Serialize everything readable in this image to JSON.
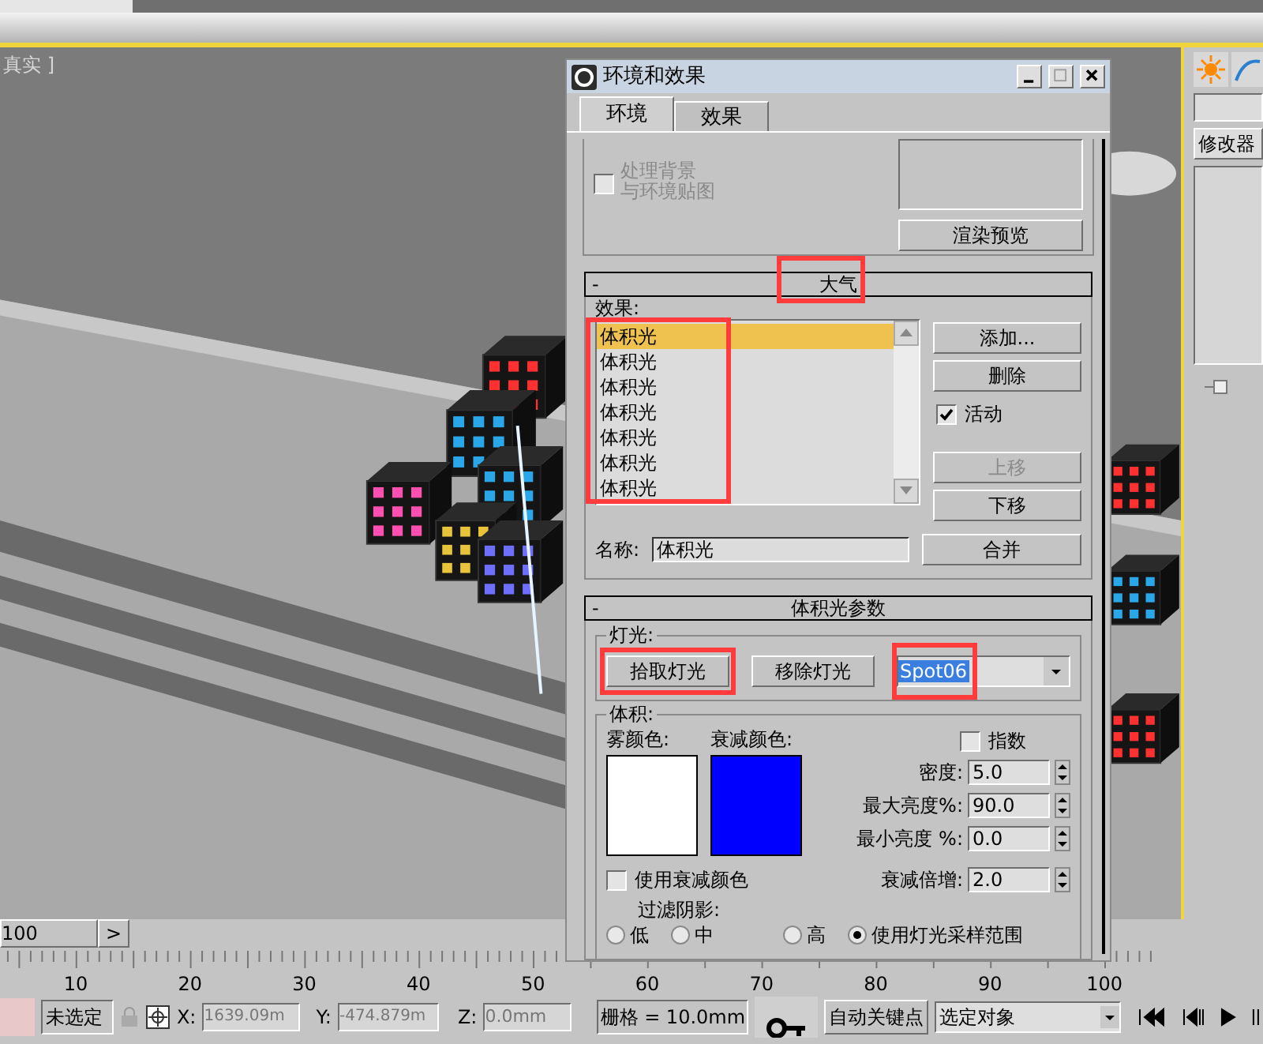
{
  "viewport": {
    "label": "真实 ]"
  },
  "command_panel": {
    "modifier_list": "修改器"
  },
  "dialog": {
    "title": "环境和效果",
    "tabs": [
      {
        "label": "环境",
        "selected": true
      },
      {
        "label": "效果",
        "selected": false
      }
    ],
    "background_section": {
      "process_background": {
        "label_lines": [
          "处理背景",
          "与环境贴图"
        ],
        "checked": false,
        "disabled": true
      },
      "render_preview_button": "渲染预览"
    },
    "atmosphere": {
      "collapse": "-",
      "title": "大气",
      "highlighted": true,
      "effects_label": "效果:",
      "effects_highlighted": true,
      "effects": [
        {
          "label": "体积光",
          "selected": true
        },
        {
          "label": "体积光",
          "selected": false
        },
        {
          "label": "体积光",
          "selected": false
        },
        {
          "label": "体积光",
          "selected": false
        },
        {
          "label": "体积光",
          "selected": false
        },
        {
          "label": "体积光",
          "selected": false
        },
        {
          "label": "体积光",
          "selected": false
        }
      ],
      "add_button": "添加...",
      "delete_button": "删除",
      "active": {
        "label": "活动",
        "checked": true
      },
      "move_up": {
        "label": "上移",
        "disabled": true
      },
      "move_down": {
        "label": "下移",
        "disabled": false
      },
      "name_label": "名称:",
      "name_value": "体积光",
      "merge_button": "合并"
    },
    "volume_light_params": {
      "collapse": "-",
      "title": "体积光参数",
      "lights_group": "灯光:",
      "pick_light": {
        "label": "拾取灯光",
        "highlighted": true
      },
      "remove_light": {
        "label": "移除灯光"
      },
      "light_select": {
        "value": "Spot06",
        "highlighted": true
      },
      "volume_group": "体积:",
      "fog_color": {
        "label": "雾颜色:",
        "color": "#ffffff"
      },
      "attenuation_color": {
        "label": "衰减颜色:",
        "color": "#0000ff"
      },
      "exponential": {
        "label": "指数",
        "checked": false
      },
      "spinners": [
        {
          "label": "密度:",
          "value": "5.0"
        },
        {
          "label": "最大亮度%:",
          "value": "90.0"
        },
        {
          "label": "最小亮度 %:",
          "value": "0.0"
        }
      ],
      "use_attenuation_color": {
        "label": "使用衰减颜色",
        "checked": false
      },
      "attenuation_multiplier": {
        "label": "衰减倍增:",
        "value": "2.0"
      },
      "filter_shadows": {
        "label": "过滤阴影:",
        "options": [
          {
            "label": "低",
            "selected": false
          },
          {
            "label": "中",
            "selected": false
          },
          {
            "label": "高",
            "selected": false
          },
          {
            "label": "使用灯光采样范围",
            "selected": true
          }
        ]
      }
    }
  },
  "timeline": {
    "frame_field": "100",
    "next_button": ">",
    "ruler_labels": [
      "10",
      "20",
      "30",
      "40",
      "50",
      "60",
      "70",
      "80",
      "90",
      "100"
    ]
  },
  "status_bar": {
    "selection": "未选定",
    "x_label": "X:",
    "x": "1639.09m",
    "y_label": "Y:",
    "y": "-474.879m",
    "z_label": "Z:",
    "z": "0.0mm",
    "grid": "栅格 = 10.0mm",
    "auto_key": "自动关键点",
    "key_filter": "选定对象"
  }
}
